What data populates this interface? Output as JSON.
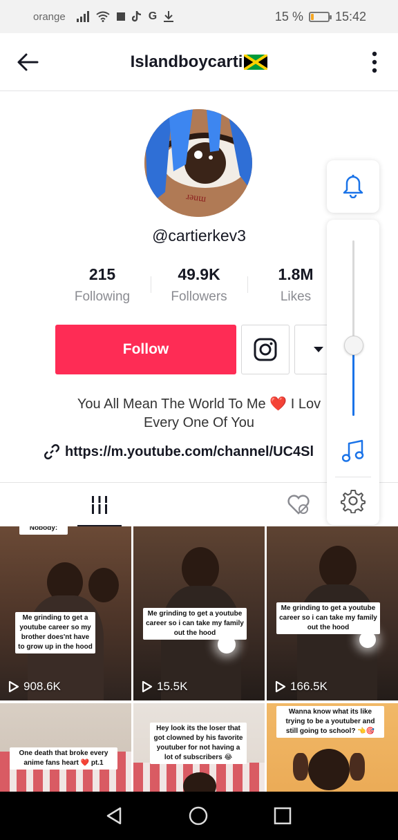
{
  "status_bar": {
    "carrier": "orange",
    "battery_percent": "15 %",
    "battery_level": 0.15,
    "time": "15:42",
    "battery_color": "#f5a623"
  },
  "header": {
    "title": "Islandboycarti",
    "back_icon": "arrow-left-icon",
    "more_icon": "more-vertical-icon"
  },
  "profile": {
    "username": "@cartierkev3",
    "stats": [
      {
        "value": "215",
        "label": "Following"
      },
      {
        "value": "49.9K",
        "label": "Followers"
      },
      {
        "value": "1.8M",
        "label": "Likes"
      }
    ],
    "follow_label": "Follow",
    "follow_color": "#fe2c55",
    "bio_line1_a": "You All Mean The World To Me",
    "bio_line1_b": "I Lov",
    "bio_line2": "Every One Of You",
    "link": "https://m.youtube.com/channel/UC4Sl"
  },
  "volume_panel": {
    "level": 0.4,
    "accent": "#1a73e8"
  },
  "videos": [
    {
      "caption": "Me grinding to get a youtube career so my brother does'nt have to grow up in the hood",
      "top_text": "Nobody:",
      "views": "908.6K"
    },
    {
      "caption": "Me grinding to get a youtube career so i can take my family out the hood",
      "views": "15.5K"
    },
    {
      "caption": "Me grinding to get a youtube career so i can take my family out the hood",
      "views": "166.5K"
    },
    {
      "caption": "One death that broke every anime fans heart ❤️ pt.1"
    },
    {
      "caption": "Hey look its the loser that got clowned by his favorite youtuber for not having a lot of subscribers 😂"
    },
    {
      "caption": "Wanna know what its like trying to be a youtuber and still going to school? 👈🎯"
    }
  ]
}
